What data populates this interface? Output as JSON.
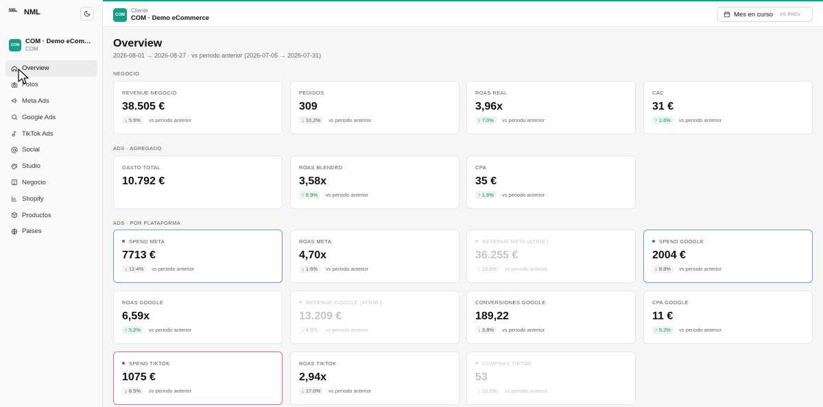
{
  "brand": {
    "logo": "NML",
    "name": "NML"
  },
  "client": {
    "badge": "COM",
    "name": "COM · Demo eCommerce",
    "name_truncated": "COM · Demo eComm...",
    "code": "COM"
  },
  "nav": [
    {
      "label": "Overview",
      "icon": "home-icon",
      "active": true
    },
    {
      "label": "Fotos",
      "icon": "camera-icon"
    },
    {
      "label": "Meta Ads",
      "icon": "megaphone-icon"
    },
    {
      "label": "Google Ads",
      "icon": "search-icon"
    },
    {
      "label": "TikTok Ads",
      "icon": "music-note-icon"
    },
    {
      "label": "Social",
      "icon": "at-sign-icon"
    },
    {
      "label": "Studio",
      "icon": "palette-icon"
    },
    {
      "label": "Negocio",
      "icon": "building-icon"
    },
    {
      "label": "Shopify",
      "icon": "bar-chart-icon"
    },
    {
      "label": "Productos",
      "icon": "box-icon"
    },
    {
      "label": "Paises",
      "icon": "globe-icon"
    }
  ],
  "topbar": {
    "caption": "Cliente",
    "badge": "COM",
    "client_name": "COM · Demo eCommerce",
    "period_label": "Mes en curso",
    "period_compare": "VS PREV"
  },
  "page": {
    "title": "Overview",
    "subtitle": "2026-08-01 → 2026-08-27 · vs periodo anterior (2026-07-05 → 2026-07-31)"
  },
  "vs_text": "vs periodo anterior",
  "sections": [
    {
      "label": "NEGOCIO"
    },
    {
      "label": "ADS · AGREGADO"
    },
    {
      "label": "ADS · POR PLATAFORMA"
    }
  ],
  "colors": {
    "accent": "#14a085",
    "meta": "#2f6fd1",
    "tiktok": "#e0324f",
    "up": "#1a8a55"
  },
  "cards": [
    {
      "label": "REVENUE NEGOCIO",
      "value": "38.505 €",
      "change": "5.5%",
      "dir": "down"
    },
    {
      "label": "PEDIDOS",
      "value": "309",
      "change": "10.2%",
      "dir": "down"
    },
    {
      "label": "ROAS REAL",
      "value": "3,96x",
      "change": "7.0%",
      "dir": "up"
    },
    {
      "label": "CAC",
      "value": "31 €",
      "change": "1.6%",
      "dir": "up"
    },
    {
      "label": "GASTO TOTAL",
      "value": "10.792 €"
    },
    {
      "label": "ROAS BLENDED",
      "value": "3,58x",
      "change": "6.9%",
      "dir": "up"
    },
    {
      "label": "CPA",
      "value": "35 €",
      "change": "1.6%",
      "dir": "up"
    },
    {
      "label": "SPEND META",
      "value": "7713 €",
      "change": "12.4%",
      "dir": "down"
    },
    {
      "label": "ROAS META",
      "value": "4,70x",
      "change": "1.6%",
      "dir": "down"
    },
    {
      "label": "REVENUE META (ATRIB.)",
      "value": "36.255 €",
      "change": "13.8%",
      "dir": "down"
    },
    {
      "label": "SPEND GOOGLE",
      "value": "2004 €",
      "change": "8.8%",
      "dir": "down"
    },
    {
      "label": "ROAS GOOGLE",
      "value": "6,59x",
      "change": "5.2%",
      "dir": "up"
    },
    {
      "label": "REVENUE GOOGLE (ATRIB.)",
      "value": "13.209 €",
      "change": "4.0%",
      "dir": "down"
    },
    {
      "label": "CONVERSIONES GOOGLE",
      "value": "189,22",
      "change": "3.8%",
      "dir": "down"
    },
    {
      "label": "CPA GOOGLE",
      "value": "11 €",
      "change": "5.2%",
      "dir": "up"
    },
    {
      "label": "SPEND TIKTOK",
      "value": "1075 €",
      "change": "8.5%",
      "dir": "down"
    },
    {
      "label": "ROAS TIKTOK",
      "value": "2,94x",
      "change": "17.0%",
      "dir": "down"
    },
    {
      "label": "COMPRAS TIKTOK",
      "value": "53",
      "change": "23.2%",
      "dir": "down"
    }
  ]
}
